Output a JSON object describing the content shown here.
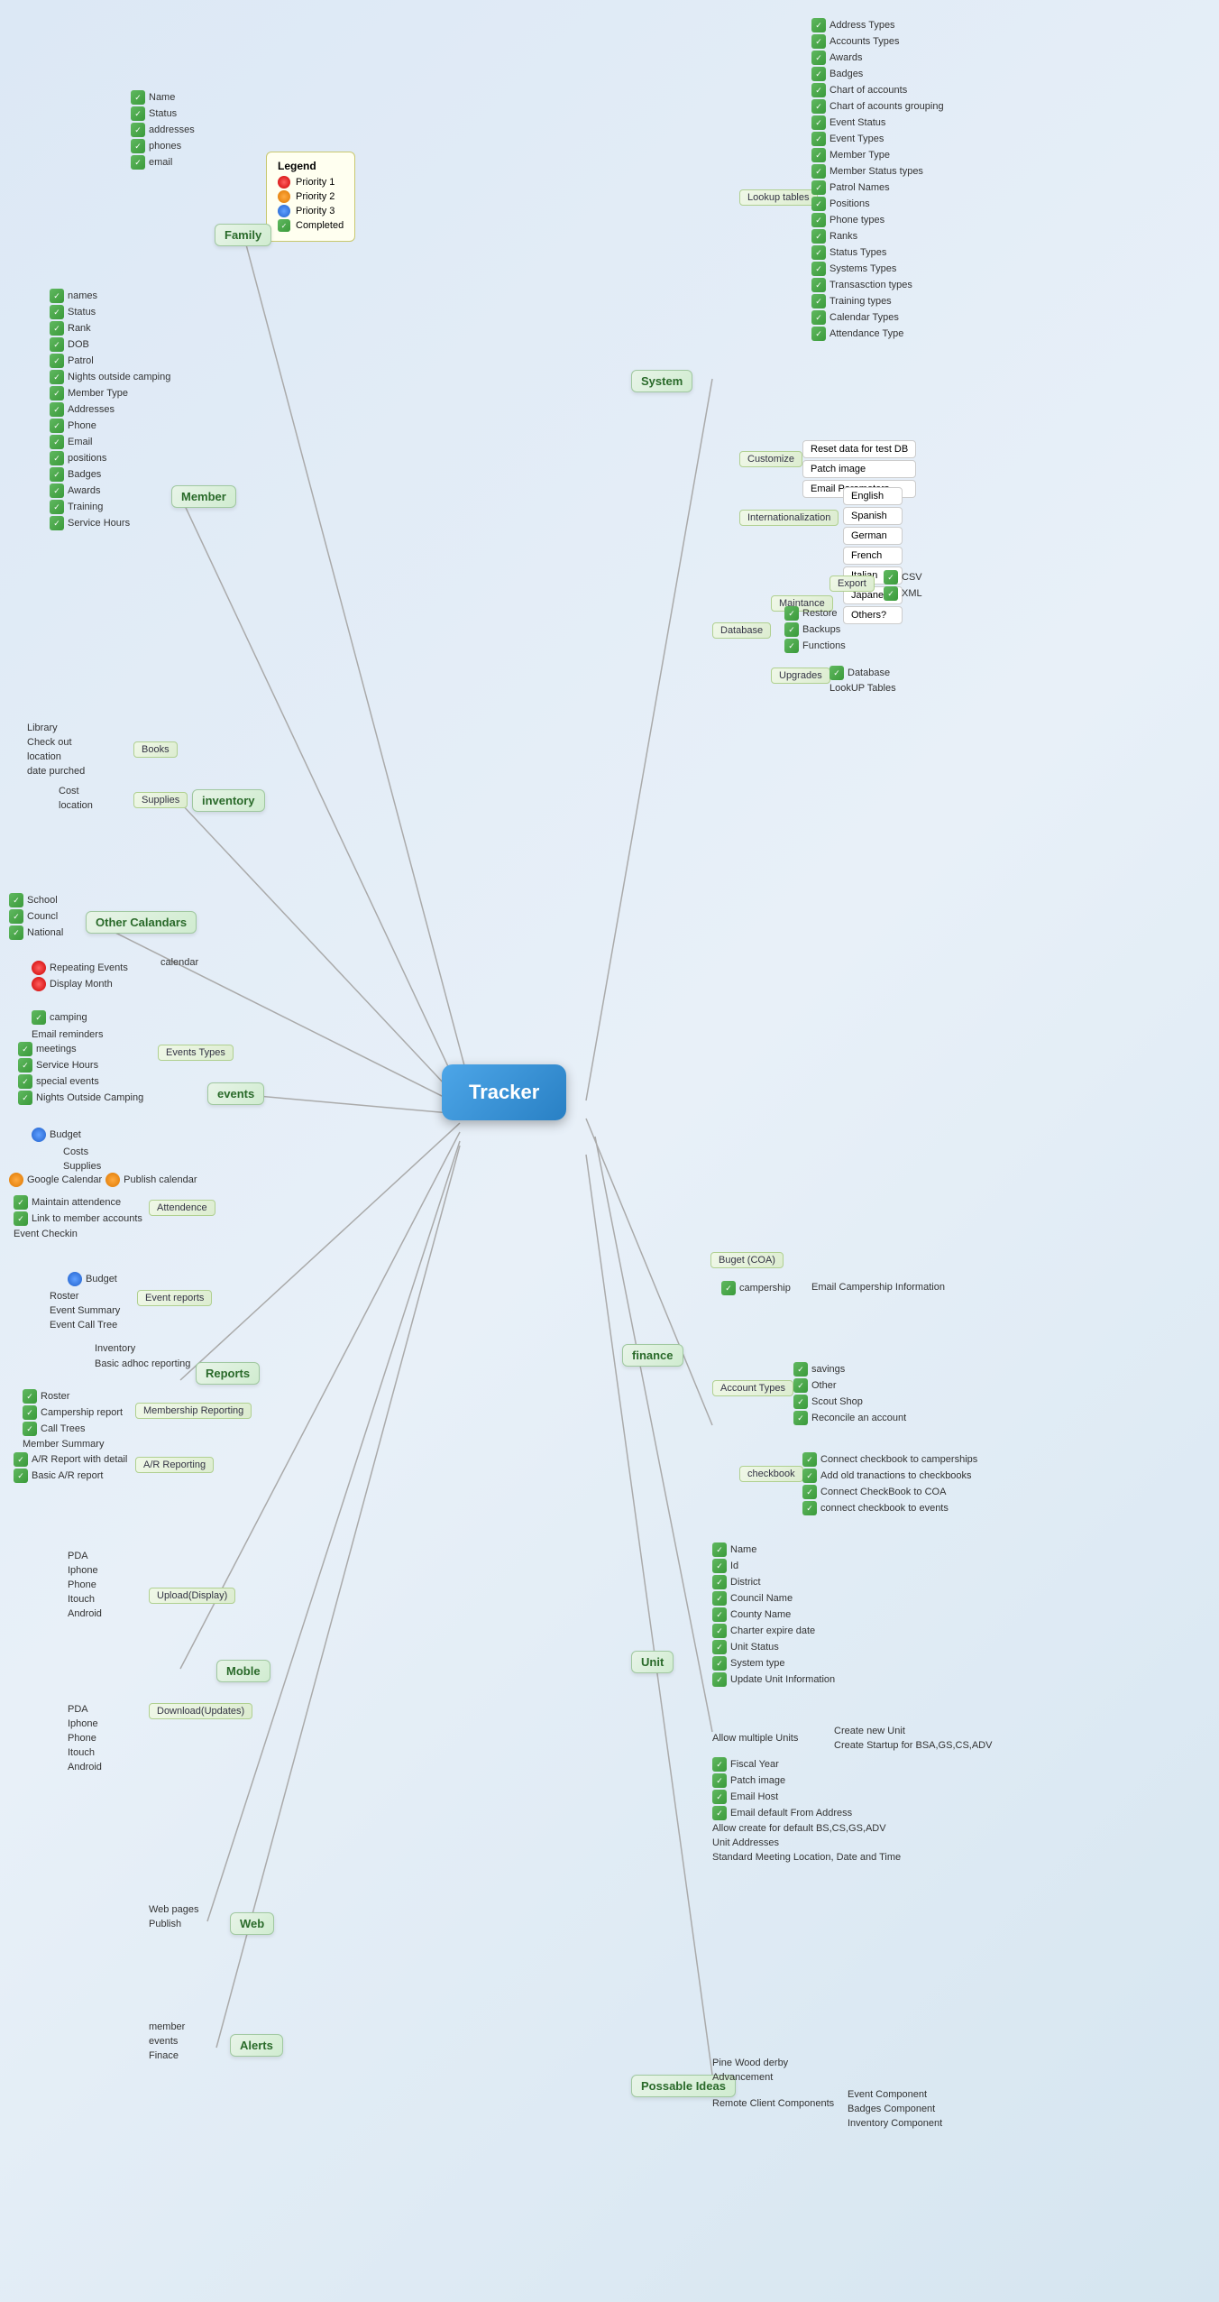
{
  "center": {
    "label": "Tracker"
  },
  "legend": {
    "title": "Legend",
    "items": [
      {
        "type": "dot-red",
        "label": "Priority 1"
      },
      {
        "type": "dot-orange",
        "label": "Priority 2"
      },
      {
        "type": "dot-blue",
        "label": "Priority 3"
      },
      {
        "type": "dot-check",
        "label": "Completed"
      }
    ]
  },
  "branches": {
    "family": {
      "label": "Family",
      "items": [
        "Name",
        "Status",
        "addresses",
        "phones",
        "email"
      ]
    },
    "member": {
      "label": "Member",
      "items": [
        "names",
        "Status",
        "Rank",
        "DOB",
        "Patrol",
        "Nights outside camping",
        "Member Type",
        "Addresses",
        "Phone",
        "Email",
        "positions",
        "Badges",
        "Awards",
        "Training",
        "Service Hours"
      ]
    },
    "inventory": {
      "label": "inventory",
      "books": [
        "Library",
        "Check out",
        "location",
        "date purched"
      ],
      "supplies": [
        "Cost",
        "location"
      ]
    },
    "other_calendars": {
      "label": "Other Calandars",
      "items": [
        "School",
        "Councl",
        "National"
      ]
    },
    "events": {
      "label": "events",
      "calendar": "calendar",
      "calendar_items": [
        "Repeating Events",
        "Display Month"
      ],
      "camping": "camping",
      "email_reminders": "Email reminders",
      "events_types": {
        "label": "Events Types",
        "items": [
          "meetings",
          "Service Hours",
          "special events",
          "Nights Outside Camping"
        ]
      },
      "budget": "Budget",
      "budget_items": [
        "Costs",
        "Supplies"
      ],
      "google_calendar": "Google Calendar",
      "publish_calendar": "Publish calendar",
      "attendence": {
        "label": "Attendence",
        "items": [
          "Maintain attendence",
          "Link to member accounts",
          "Event Checkin"
        ]
      }
    },
    "reports": {
      "label": "Reports",
      "event_reports": {
        "label": "Event reports",
        "items": [
          "Roster",
          "Event Summary",
          "Event Call Tree"
        ]
      },
      "basic_adhoc": "Basic adhoc reporting",
      "inventory": "Inventory",
      "membership": {
        "label": "Membership Reporting",
        "items": [
          "Roster",
          "Campership report",
          "Call Trees",
          "Member Summary"
        ]
      },
      "ar_reporting": {
        "label": "A/R Reporting",
        "items": [
          "A/R Report with detail",
          "Basic A/R report"
        ]
      }
    },
    "mobile": {
      "label": "Moble",
      "upload": {
        "label": "Upload(Display)",
        "items": [
          "PDA",
          "Iphone",
          "Phone",
          "Itouch",
          "Android"
        ]
      },
      "download": {
        "label": "Download(Updates)",
        "items": [
          "PDA",
          "Iphone",
          "Phone",
          "Itouch",
          "Android"
        ]
      }
    },
    "web": {
      "label": "Web",
      "items": [
        "Web pages",
        "Publish"
      ]
    },
    "alerts": {
      "label": "Alerts",
      "items": [
        "member",
        "events",
        "Finace"
      ]
    },
    "system": {
      "label": "System",
      "lookup_tables": {
        "label": "Lookup tables",
        "items": [
          "Address Types",
          "Accounts Types",
          "Awards",
          "Badges",
          "Chart of accounts",
          "Chart of acounts grouping",
          "Event Status",
          "Event Types",
          "Member Type",
          "Member Status types",
          "Patrol Names",
          "Positions",
          "Phone types",
          "Ranks",
          "Status Types",
          "Systems Types",
          "Transasction types",
          "Training types",
          "Calendar Types",
          "Attendance Type"
        ]
      },
      "customize": {
        "label": "Customize",
        "items": [
          "Reset data for test DB",
          "Patch image",
          "Email Parameters"
        ]
      },
      "internationalization": {
        "label": "Internationalization",
        "items": [
          "English",
          "Spanish",
          "German",
          "French",
          "Italian",
          "Japanese",
          "Others?"
        ]
      },
      "database": {
        "label": "Database",
        "maintance": {
          "label": "Maintance",
          "export": {
            "label": "Export",
            "items": [
              "CSV",
              "XML"
            ]
          },
          "items": [
            "Restore",
            "Backups",
            "Functions"
          ]
        },
        "upgrades": {
          "label": "Upgrades",
          "items": [
            "Database",
            "LookUP Tables"
          ]
        }
      }
    },
    "finance": {
      "label": "finance",
      "buget": {
        "label": "Buget (COA)",
        "campership": "campership",
        "campership_email": "Email Campership Information"
      },
      "account_types": {
        "label": "Account Types",
        "items": [
          "savings",
          "Other",
          "Scout Shop",
          "Reconcile an account"
        ]
      },
      "checkbook": {
        "label": "checkbook",
        "items": [
          "Connect checkbook to camperships",
          "Add old tranactions to checkbooks",
          "Connect CheckBook to COA",
          "connect checkbook to events"
        ]
      }
    },
    "unit": {
      "label": "Unit",
      "items": [
        "Name",
        "Id",
        "District",
        "Council Name",
        "County Name",
        "Charter expire date",
        "Unit Status",
        "System type",
        "Update Unit Information"
      ],
      "allow_multiple": {
        "label": "Allow multiple Units",
        "items": [
          "Create new Unit",
          "Create Startup for BSA,GS,CS,ADV"
        ]
      },
      "more_items": [
        "Fiscal Year",
        "Patch image",
        "Email Host",
        "Email default From Address",
        "Allow create for default BS,CS,GS,ADV",
        "Unit Addresses",
        "Standard Meeting Location, Date and Time"
      ]
    },
    "possible_ideas": {
      "label": "Possable Ideas",
      "items": [
        "Pine Wood derby",
        "Advancement"
      ],
      "remote_client": {
        "label": "Remote Client Components",
        "items": [
          "Event Component",
          "Badges Component",
          "Inventory Component"
        ]
      }
    }
  }
}
